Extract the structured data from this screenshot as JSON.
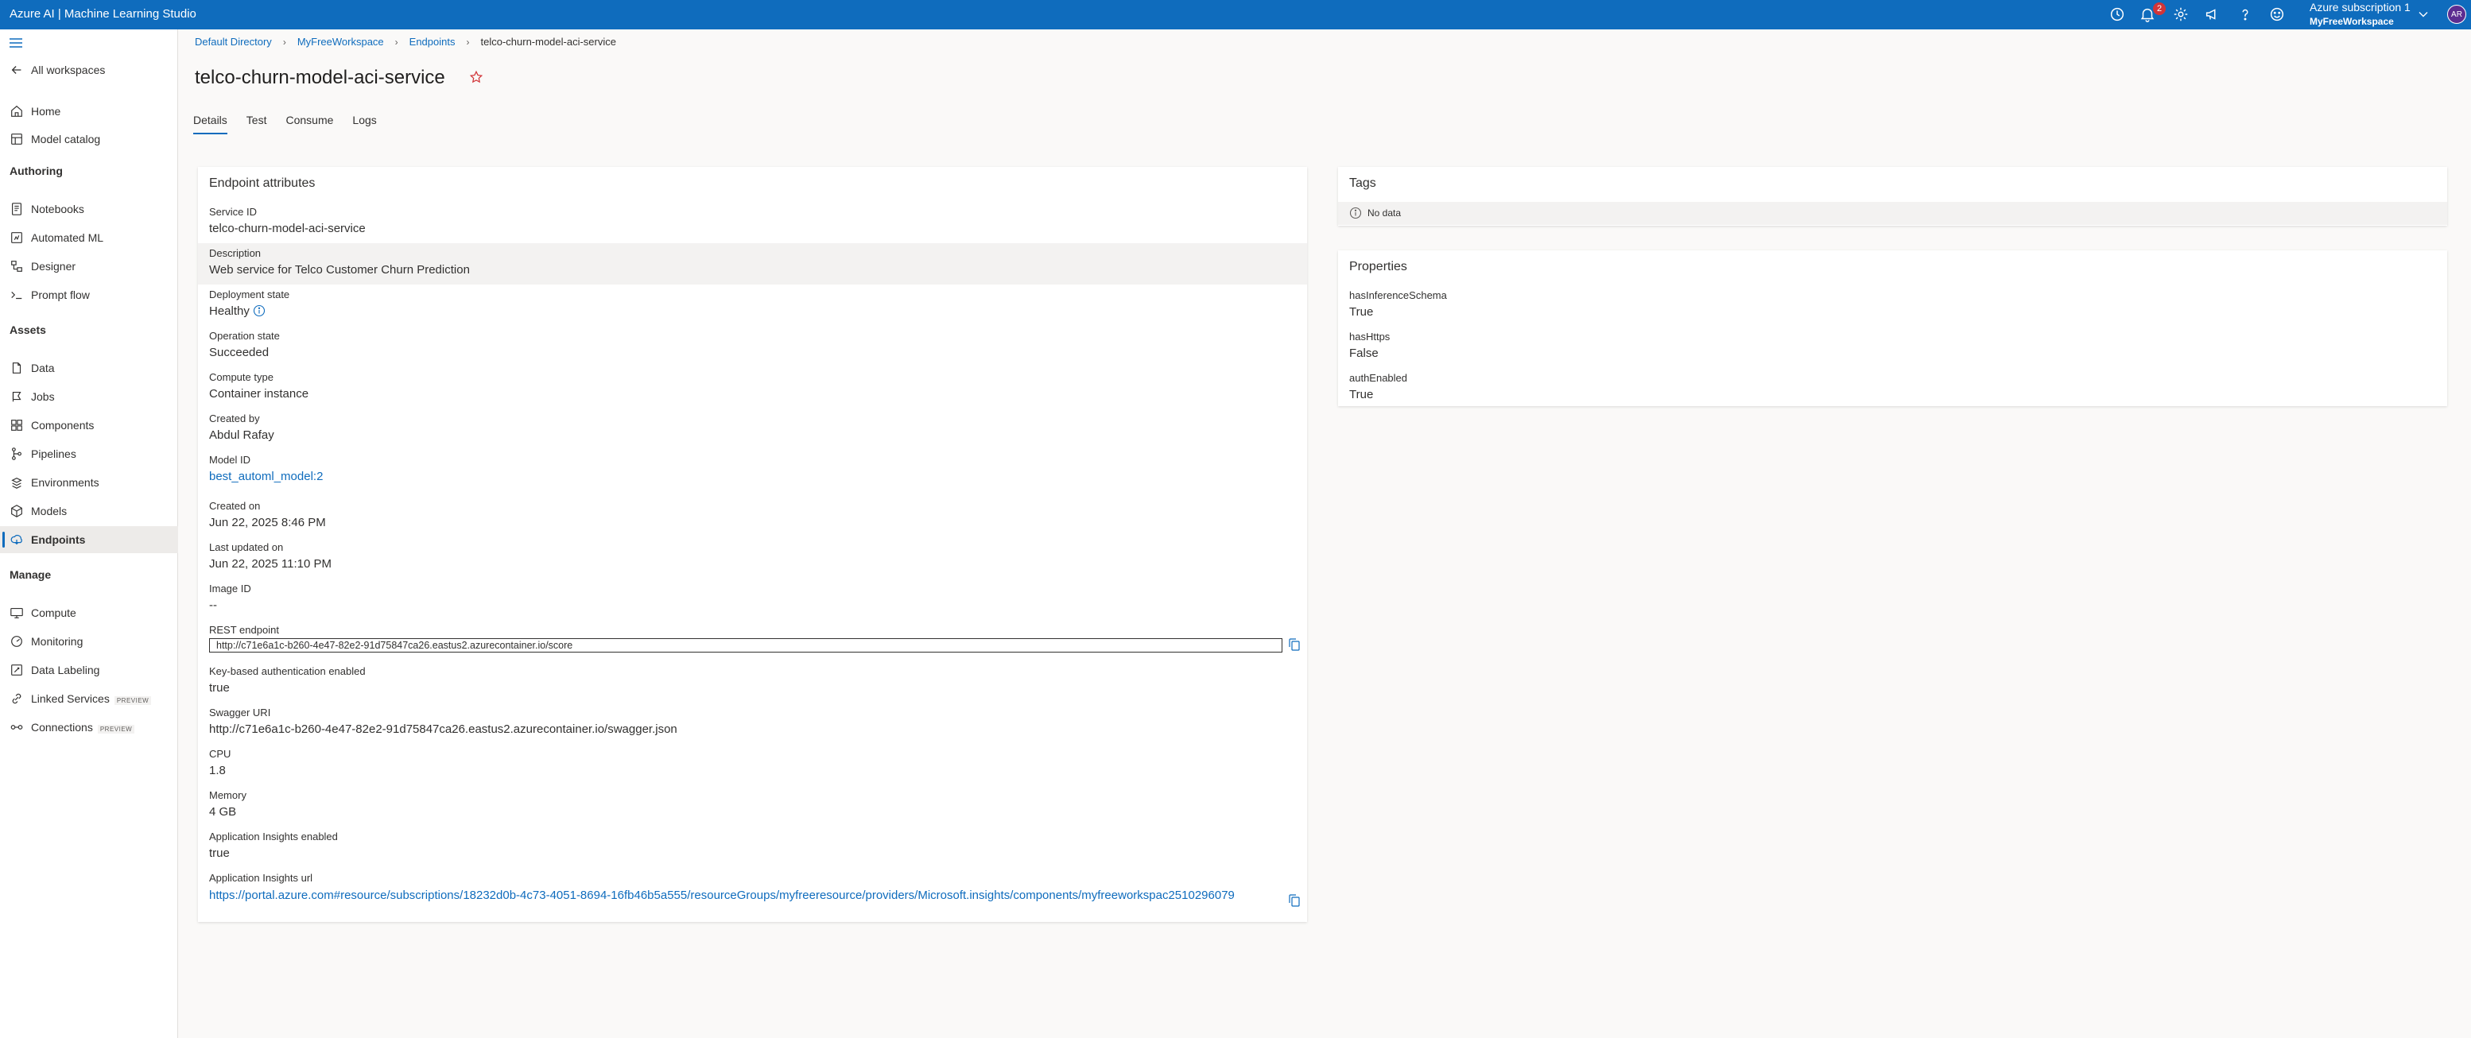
{
  "app": {
    "title": "Azure AI | Machine Learning Studio"
  },
  "topbar": {
    "notification_count": "2",
    "subscription": "Azure subscription 1",
    "workspace": "MyFreeWorkspace",
    "avatar_initials": "AR",
    "icons": [
      "history-icon",
      "bell-icon",
      "gear-icon",
      "megaphone-icon",
      "help-icon",
      "feedback-smiley-icon",
      "chevron-down-icon"
    ]
  },
  "sidebar": {
    "back": "All workspaces",
    "top_items": [
      {
        "label": "Home",
        "icon": "home-icon"
      },
      {
        "label": "Model catalog",
        "icon": "catalog-icon"
      }
    ],
    "sections": [
      {
        "title": "Authoring",
        "items": [
          {
            "label": "Notebooks",
            "icon": "notebook-icon"
          },
          {
            "label": "Automated ML",
            "icon": "automl-icon"
          },
          {
            "label": "Designer",
            "icon": "designer-icon"
          },
          {
            "label": "Prompt flow",
            "icon": "prompt-flow-icon"
          }
        ]
      },
      {
        "title": "Assets",
        "items": [
          {
            "label": "Data",
            "icon": "data-icon"
          },
          {
            "label": "Jobs",
            "icon": "jobs-icon"
          },
          {
            "label": "Components",
            "icon": "components-icon"
          },
          {
            "label": "Pipelines",
            "icon": "pipelines-icon"
          },
          {
            "label": "Environments",
            "icon": "environments-icon"
          },
          {
            "label": "Models",
            "icon": "models-icon"
          },
          {
            "label": "Endpoints",
            "icon": "endpoints-icon",
            "active": true
          }
        ]
      },
      {
        "title": "Manage",
        "items": [
          {
            "label": "Compute",
            "icon": "compute-icon"
          },
          {
            "label": "Monitoring",
            "icon": "monitoring-icon"
          },
          {
            "label": "Data Labeling",
            "icon": "labeling-icon"
          },
          {
            "label": "Linked Services",
            "icon": "linked-services-icon",
            "tag": "PREVIEW"
          },
          {
            "label": "Connections",
            "icon": "connections-icon",
            "tag": "PREVIEW"
          }
        ]
      }
    ]
  },
  "breadcrumb": [
    "Default Directory",
    "MyFreeWorkspace",
    "Endpoints",
    "telco-churn-model-aci-service"
  ],
  "page": {
    "title": "telco-churn-model-aci-service",
    "tabs": [
      "Details",
      "Test",
      "Consume",
      "Logs"
    ],
    "active_tab": "Details"
  },
  "attributes": {
    "title": "Endpoint attributes",
    "items": [
      {
        "label": "Service ID",
        "value": "telco-churn-model-aci-service"
      },
      {
        "label": "Description",
        "value": "Web service for Telco Customer Churn Prediction"
      },
      {
        "label": "Deployment state",
        "value": "Healthy"
      },
      {
        "label": "Operation state",
        "value": "Succeeded"
      },
      {
        "label": "Compute type",
        "value": "Container instance"
      },
      {
        "label": "Created by",
        "value": "Abdul Rafay"
      },
      {
        "label": "Model ID",
        "value": "best_automl_model:2"
      },
      {
        "label": "Created on",
        "value": "Jun 22, 2025 8:46 PM"
      },
      {
        "label": "Last updated on",
        "value": "Jun 22, 2025 11:10 PM"
      },
      {
        "label": "Image ID",
        "value": "--"
      },
      {
        "label": "REST endpoint",
        "value": "http://c71e6a1c-b260-4e47-82e2-91d75847ca26.eastus2.azurecontainer.io/score"
      },
      {
        "label": "Key-based authentication enabled",
        "value": "true"
      },
      {
        "label": "Swagger URI",
        "value": "http://c71e6a1c-b260-4e47-82e2-91d75847ca26.eastus2.azurecontainer.io/swagger.json"
      },
      {
        "label": "CPU",
        "value": "1.8"
      },
      {
        "label": "Memory",
        "value": "4 GB"
      },
      {
        "label": "Application Insights enabled",
        "value": "true"
      },
      {
        "label": "Application Insights url",
        "value": "https://portal.azure.com#resource/subscriptions/18232d0b-4c73-4051-8694-16fb46b5a555/resourceGroups/myfreeresource/providers/Microsoft.insights/components/myfreeworkspac2510296079"
      }
    ]
  },
  "tags": {
    "title": "Tags",
    "empty_text": "No data"
  },
  "properties": {
    "title": "Properties",
    "items": [
      {
        "label": "hasInferenceSchema",
        "value": "True"
      },
      {
        "label": "hasHttps",
        "value": "False"
      },
      {
        "label": "authEnabled",
        "value": "True"
      }
    ]
  }
}
